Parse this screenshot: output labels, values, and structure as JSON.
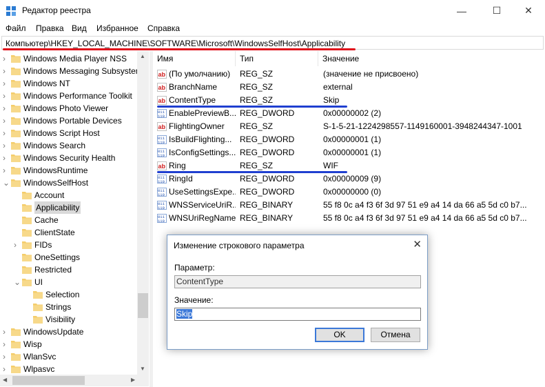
{
  "window": {
    "title": "Редактор реестра",
    "minimize": "—",
    "maximize": "☐",
    "close": "✕"
  },
  "menu": [
    "Файл",
    "Правка",
    "Вид",
    "Избранное",
    "Справка"
  ],
  "address": "Компьютер\\HKEY_LOCAL_MACHINE\\SOFTWARE\\Microsoft\\WindowsSelfHost\\Applicability",
  "tree": [
    {
      "label": "Windows Media Player NSS",
      "level": 0,
      "expander": ">"
    },
    {
      "label": "Windows Messaging Subsystem",
      "level": 0,
      "expander": ">"
    },
    {
      "label": "Windows NT",
      "level": 0,
      "expander": ">"
    },
    {
      "label": "Windows Performance Toolkit",
      "level": 0,
      "expander": ">"
    },
    {
      "label": "Windows Photo Viewer",
      "level": 0,
      "expander": ">"
    },
    {
      "label": "Windows Portable Devices",
      "level": 0,
      "expander": ">"
    },
    {
      "label": "Windows Script Host",
      "level": 0,
      "expander": ">"
    },
    {
      "label": "Windows Search",
      "level": 0,
      "expander": ">"
    },
    {
      "label": "Windows Security Health",
      "level": 0,
      "expander": ">"
    },
    {
      "label": "WindowsRuntime",
      "level": 0,
      "expander": ">"
    },
    {
      "label": "WindowsSelfHost",
      "level": 0,
      "expander": "v"
    },
    {
      "label": "Account",
      "level": 1,
      "expander": ""
    },
    {
      "label": "Applicability",
      "level": 1,
      "expander": "",
      "selected": true
    },
    {
      "label": "Cache",
      "level": 1,
      "expander": ""
    },
    {
      "label": "ClientState",
      "level": 1,
      "expander": ""
    },
    {
      "label": "FIDs",
      "level": 1,
      "expander": ">"
    },
    {
      "label": "OneSettings",
      "level": 1,
      "expander": ""
    },
    {
      "label": "Restricted",
      "level": 1,
      "expander": ""
    },
    {
      "label": "UI",
      "level": 1,
      "expander": "v"
    },
    {
      "label": "Selection",
      "level": 2,
      "expander": ""
    },
    {
      "label": "Strings",
      "level": 2,
      "expander": ""
    },
    {
      "label": "Visibility",
      "level": 2,
      "expander": ""
    },
    {
      "label": "WindowsUpdate",
      "level": 0,
      "expander": ">"
    },
    {
      "label": "Wisp",
      "level": 0,
      "expander": ">"
    },
    {
      "label": "WlanSvc",
      "level": 0,
      "expander": ">"
    },
    {
      "label": "Wlpasvc",
      "level": 0,
      "expander": ">"
    }
  ],
  "columns": {
    "name": "Имя",
    "type": "Тип",
    "value": "Значение"
  },
  "values": [
    {
      "name": "(По умолчанию)",
      "type": "REG_SZ",
      "value": "(значение не присвоено)",
      "kind": "sz"
    },
    {
      "name": "BranchName",
      "type": "REG_SZ",
      "value": "external",
      "kind": "sz"
    },
    {
      "name": "ContentType",
      "type": "REG_SZ",
      "value": "Skip",
      "kind": "sz"
    },
    {
      "name": "EnablePreviewB...",
      "type": "REG_DWORD",
      "value": "0x00000002 (2)",
      "kind": "bin"
    },
    {
      "name": "FlightingOwner",
      "type": "REG_SZ",
      "value": "S-1-5-21-1224298557-1149160001-3948244347-1001",
      "kind": "sz"
    },
    {
      "name": "IsBuildFlighting...",
      "type": "REG_DWORD",
      "value": "0x00000001 (1)",
      "kind": "bin"
    },
    {
      "name": "IsConfigSettings...",
      "type": "REG_DWORD",
      "value": "0x00000001 (1)",
      "kind": "bin"
    },
    {
      "name": "Ring",
      "type": "REG_SZ",
      "value": "WIF",
      "kind": "sz"
    },
    {
      "name": "RingId",
      "type": "REG_DWORD",
      "value": "0x00000009 (9)",
      "kind": "bin"
    },
    {
      "name": "UseSettingsExpe...",
      "type": "REG_DWORD",
      "value": "0x00000000 (0)",
      "kind": "bin"
    },
    {
      "name": "WNSServiceUriR...",
      "type": "REG_BINARY",
      "value": "55 f8 0c a4 f3 6f 3d 97 51 e9 a4 14 da 66 a5 5d c0 b7...",
      "kind": "bin"
    },
    {
      "name": "WNSUriRegName",
      "type": "REG_BINARY",
      "value": "55 f8 0c a4 f3 6f 3d 97 51 e9 a4 14 da 66 a5 5d c0 b7...",
      "kind": "bin"
    }
  ],
  "dialog": {
    "title": "Изменение строкового параметра",
    "close": "✕",
    "param_label": "Параметр:",
    "param_value": "ContentType",
    "value_label": "Значение:",
    "value": "Skip",
    "ok": "OK",
    "cancel": "Отмена"
  },
  "colors": {
    "highlight_red": "#e0101a",
    "highlight_blue": "#1f3fd0",
    "folder": "#f4cd6b",
    "selection": "#3b78d8"
  }
}
